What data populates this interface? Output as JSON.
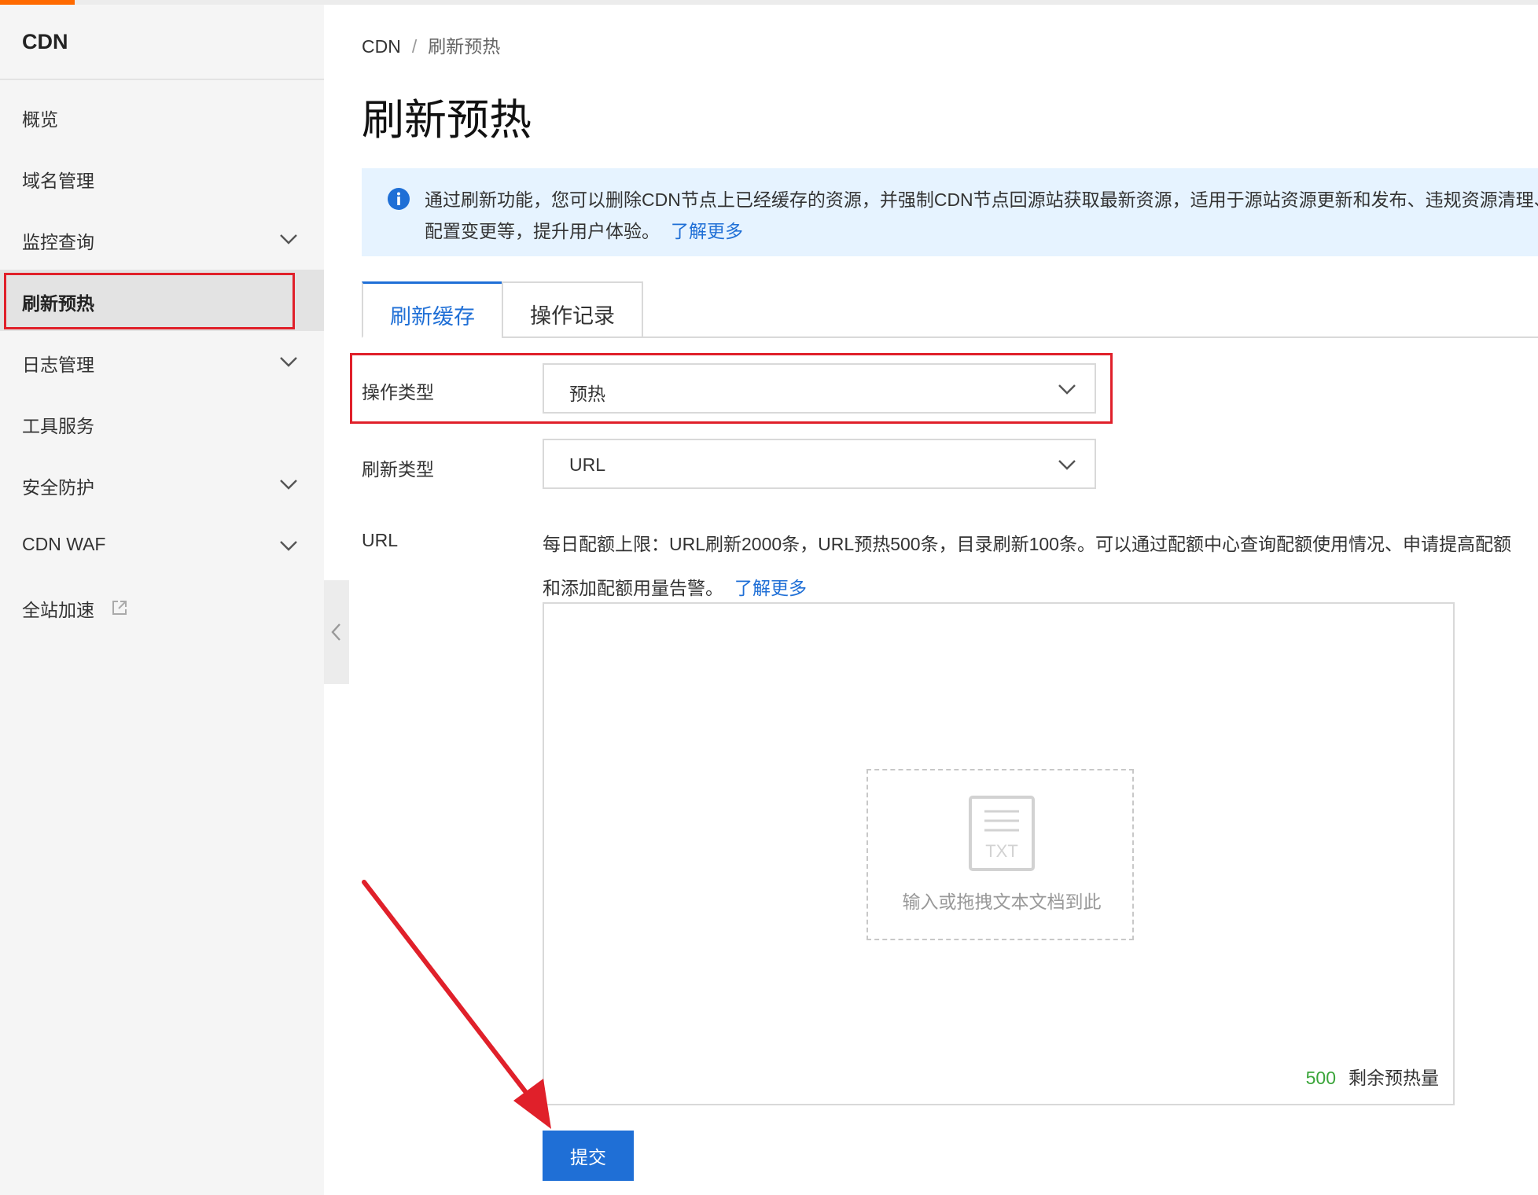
{
  "app": {
    "title": "CDN"
  },
  "sidebar": {
    "items": [
      {
        "label": "概览",
        "has_chevron": false
      },
      {
        "label": "域名管理",
        "has_chevron": false
      },
      {
        "label": "监控查询",
        "has_chevron": true
      },
      {
        "label": "刷新预热",
        "has_chevron": false,
        "active": true
      },
      {
        "label": "日志管理",
        "has_chevron": true
      },
      {
        "label": "工具服务",
        "has_chevron": false
      },
      {
        "label": "安全防护",
        "has_chevron": true
      },
      {
        "label": "CDN WAF",
        "has_chevron": true
      },
      {
        "label": "全站加速",
        "has_chevron": false,
        "external": true
      }
    ]
  },
  "breadcrumb": {
    "root": "CDN",
    "separator": "/",
    "current": "刷新预热"
  },
  "page": {
    "title": "刷新预热"
  },
  "info": {
    "text": "通过刷新功能，您可以删除CDN节点上已经缓存的资源，并强制CDN节点回源站获取最新资源，适用于源站资源更新和发布、违规资源清理、域名配置变更等，提升用户体验。",
    "link": "了解更多"
  },
  "tabs": [
    {
      "label": "刷新缓存",
      "active": true
    },
    {
      "label": "操作记录",
      "active": false
    }
  ],
  "form": {
    "operation_type": {
      "label": "操作类型",
      "value": "预热"
    },
    "refresh_type": {
      "label": "刷新类型",
      "value": "URL"
    },
    "url": {
      "label": "URL",
      "quota_text": "每日配额上限：URL刷新2000条，URL预热500条，目录刷新100条。可以通过配额中心查询配额使用情况、申请提高配额和添加配额用量告警。",
      "quota_link": "了解更多",
      "drop_icon_text": "TXT",
      "drop_text": "输入或拖拽文本文档到此",
      "remaining_count": "500",
      "remaining_label": "剩余预热量"
    },
    "submit_label": "提交"
  },
  "colors": {
    "accent_blue": "#1f6fd6",
    "brand_orange": "#ff6a00",
    "highlight_red": "#e0202a",
    "remaining_green": "#3aa53a",
    "info_bg": "#e6f3ff"
  },
  "icons": {
    "info": "info-circle-icon",
    "chevron": "chevron-down-icon",
    "external": "external-link-icon",
    "collapse": "chevron-left-icon",
    "txt_file": "txt-file-icon"
  }
}
